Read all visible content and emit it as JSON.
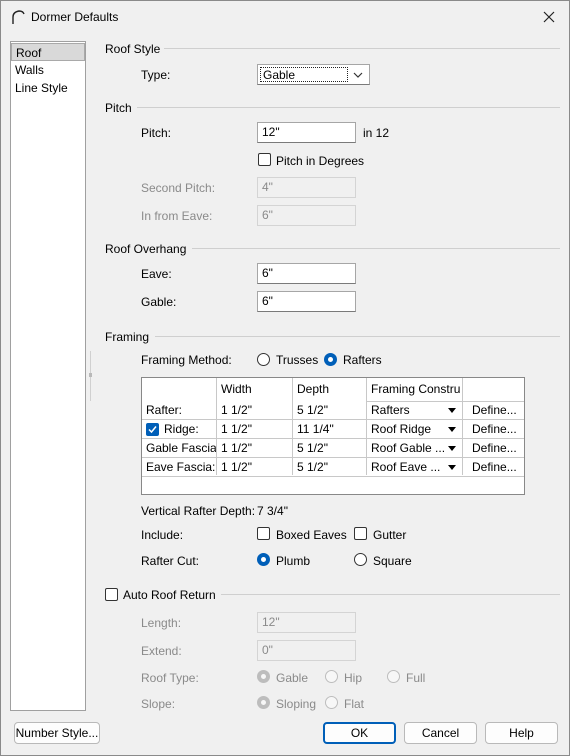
{
  "window": {
    "title": "Dormer Defaults"
  },
  "sidebar": {
    "items": [
      {
        "label": "Roof"
      },
      {
        "label": "Walls"
      },
      {
        "label": "Line Style"
      }
    ]
  },
  "roof_style": {
    "group": "Roof Style",
    "type_label": "Type:",
    "type_value": "Gable"
  },
  "pitch": {
    "group": "Pitch",
    "pitch_label": "Pitch:",
    "pitch_value": "12\"",
    "pitch_unit": "in 12",
    "degrees_label": "Pitch in Degrees",
    "second_label": "Second Pitch:",
    "second_value": "4\"",
    "eave_label": "In from Eave:",
    "eave_value": "6\""
  },
  "overhang": {
    "group": "Roof Overhang",
    "eave_label": "Eave:",
    "eave_value": "6\"",
    "gable_label": "Gable:",
    "gable_value": "6\""
  },
  "framing": {
    "group": "Framing",
    "method_label": "Framing Method:",
    "trusses_label": "Trusses",
    "rafters_label": "Rafters",
    "columns": [
      "",
      "Width",
      "Depth",
      "Framing Constru",
      ""
    ],
    "rows": [
      {
        "name": "Rafter:",
        "width": "1 1/2\"",
        "depth": "5 1/2\"",
        "construction": "Rafters",
        "define": "Define..."
      },
      {
        "name": "Ridge:",
        "width": "1 1/2\"",
        "depth": "11 1/4\"",
        "construction": "Roof Ridge",
        "define": "Define..."
      },
      {
        "name": "Gable Fascia:",
        "width": "1 1/2\"",
        "depth": "5 1/2\"",
        "construction": "Roof Gable ...",
        "define": "Define..."
      },
      {
        "name": "Eave Fascia:",
        "width": "1 1/2\"",
        "depth": "5 1/2\"",
        "construction": "Roof Eave ...",
        "define": "Define..."
      }
    ],
    "vertical_depth_label": "Vertical Rafter Depth:",
    "vertical_depth_value": "7 3/4\"",
    "include_label": "Include:",
    "boxed_eaves_label": "Boxed Eaves",
    "gutter_label": "Gutter",
    "rafter_cut_label": "Rafter Cut:",
    "plumb_label": "Plumb",
    "square_label": "Square"
  },
  "auto_return": {
    "label": "Auto Roof Return",
    "length_label": "Length:",
    "length_value": "12\"",
    "extend_label": "Extend:",
    "extend_value": "0\"",
    "roof_type_label": "Roof Type:",
    "gable_label": "Gable",
    "hip_label": "Hip",
    "full_label": "Full",
    "slope_label": "Slope:",
    "sloping_label": "Sloping",
    "flat_label": "Flat"
  },
  "buttons": {
    "number_style": "Number Style...",
    "ok": "OK",
    "cancel": "Cancel",
    "help": "Help"
  },
  "colors": {
    "accent": "#005fb8",
    "background": "#f0f0f0"
  }
}
